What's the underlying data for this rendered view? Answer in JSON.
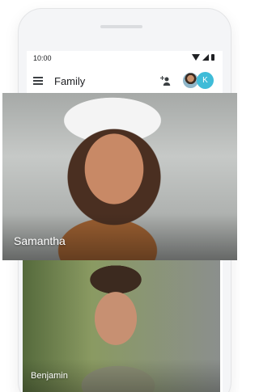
{
  "status_bar": {
    "time": "10:00"
  },
  "app_bar": {
    "title": "Family",
    "avatar_letter": "K"
  },
  "cards": [
    {
      "name": "Samantha"
    },
    {
      "name": "Benjamin"
    }
  ],
  "icons": {
    "menu": "menu-icon",
    "add_person": "add-person-icon",
    "wifi": "wifi-icon",
    "cell": "cell-signal-icon",
    "battery": "battery-icon"
  },
  "colors": {
    "accent_avatar": "#3fbcd8",
    "text": "#202124"
  }
}
